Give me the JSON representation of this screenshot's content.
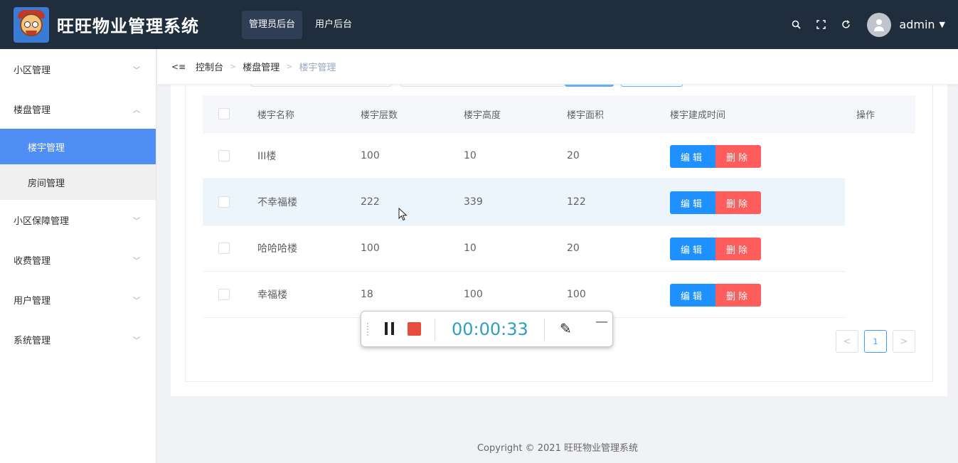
{
  "app": {
    "title": "旺旺物业管理系统"
  },
  "topnav": {
    "items": [
      "管理员后台",
      "用户后台"
    ]
  },
  "user": {
    "name": "admin"
  },
  "sidebar": {
    "items": [
      {
        "label": "小区管理"
      },
      {
        "label": "楼盘管理"
      },
      {
        "label": "楼宇管理"
      },
      {
        "label": "房间管理"
      },
      {
        "label": "小区保障管理"
      },
      {
        "label": "收费管理"
      },
      {
        "label": "用户管理"
      },
      {
        "label": "系统管理"
      }
    ]
  },
  "breadcrumb": {
    "items": [
      "控制台",
      "楼盘管理",
      "楼宇管理"
    ]
  },
  "table": {
    "headers": [
      "楼宇名称",
      "楼宇层数",
      "楼宇高度",
      "楼宇面积",
      "楼宇建成时间",
      "操作"
    ],
    "rows": [
      {
        "name": "III楼",
        "floors": "100",
        "height": "10",
        "area": "20"
      },
      {
        "name": "不幸福楼",
        "floors": "222",
        "height": "339",
        "area": "122"
      },
      {
        "name": "哈哈哈楼",
        "floors": "100",
        "height": "10",
        "area": "20"
      },
      {
        "name": "幸福楼",
        "floors": "18",
        "height": "100",
        "area": "100"
      }
    ],
    "edit_label": "编辑",
    "delete_label": "删除"
  },
  "pagination": {
    "current": "1"
  },
  "recorder": {
    "time": "00:00:33"
  },
  "footer": {
    "text": "Copyright © 2021 旺旺物业管理系统"
  },
  "colors": {
    "header_bg": "#1f2d3d",
    "active_menu": "#4f8ff5",
    "edit": "#1e90ff",
    "delete": "#ff5c5c",
    "timer": "#2d9fc2"
  }
}
